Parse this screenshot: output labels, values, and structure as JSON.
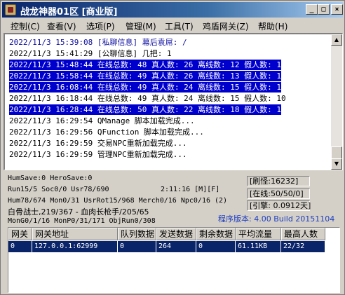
{
  "window": {
    "title": "战龙神器01区 [商业版]",
    "min_glyph": "_",
    "max_glyph": "□",
    "close_glyph": "×"
  },
  "menu": [
    "控制(C)",
    "查看(V)",
    "选项(P)",
    "管理(M)",
    "工具(T)",
    "鸡盾网关(Z)",
    "帮助(H)"
  ],
  "log": [
    {
      "text": "2022/11/3 15:39:08 [私聊信息] 幕后袁屌: /",
      "style": "blue"
    },
    {
      "text": "2022/11/3 15:41:29 [公聊信息] 几把: 1",
      "style": "normal"
    },
    {
      "text": "2022/11/3 15:48:44 在线总数: 48 真人数: 26 离线数: 12 假人数: 10",
      "style": "sel"
    },
    {
      "text": "2022/11/3 15:58:44 在线总数: 49 真人数: 26 离线数: 13 假人数: 10",
      "style": "sel"
    },
    {
      "text": "2022/11/3 16:08:44 在线总数: 49 真人数: 24 离线数: 15 假人数: 10",
      "style": "sel"
    },
    {
      "text": "2022/11/3 16:18:44 在线总数: 49 真人数: 24 离线数: 15 假人数: 10",
      "style": "normal"
    },
    {
      "text": "2022/11/3 16:28:44 在线总数: 50 真人数: 22 离线数: 18 假人数: 10",
      "style": "sel"
    },
    {
      "text": "2022/11/3 16:29:54 QManage 脚本加载完成...",
      "style": "normal"
    },
    {
      "text": "2022/11/3 16:29:56 QFunction 脚本加载完成...",
      "style": "normal"
    },
    {
      "text": "2022/11/3 16:29:59 交易NPC重新加载完成...",
      "style": "normal"
    },
    {
      "text": "2022/11/3 16:29:59 管理NPC重新加载完成...",
      "style": "normal"
    }
  ],
  "status": {
    "line1": "HumSave:0 HeroSave:0",
    "line2": "Run15/5 Soc0/0 Usr78/690",
    "time": "2:11:16 [M][F]",
    "line3": "Hum78/674 Mon0/31 UsrRot15/968 Merch0/16 Npc0/16 (2)",
    "line4": "白骨战士,219/367 - 血肉长枪手/205/65",
    "line5": "MonG0/1/16 MonP0/31/171 ObjRun0/308",
    "brush": "[刷怪:16232]",
    "online": "[在线:50/50/0]",
    "engine": "[引擎: 0.0912天]",
    "version": "程序版本: 4.00 Build 20151104"
  },
  "grid": {
    "columns": [
      "网关",
      "网关地址",
      "队列数据",
      "发送数据",
      "剩余数据",
      "平均流量",
      "最高人数"
    ],
    "rows": [
      [
        "0",
        "127.0.0.1:62999",
        "0",
        "264",
        "0",
        "61.11KB",
        "22/32"
      ]
    ]
  }
}
